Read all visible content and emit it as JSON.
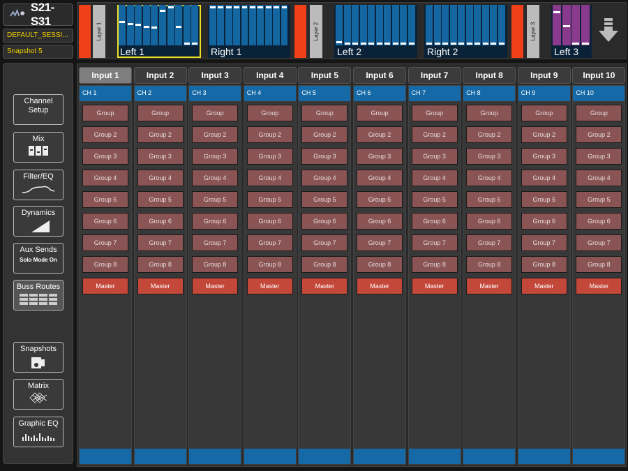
{
  "header": {
    "app_title": "S21-S31",
    "session_name": "DEFAULT_SESSI...",
    "snapshot_name": "Snapshot 5"
  },
  "layers": [
    {
      "tab_label": "Layer 1",
      "groups": [
        {
          "label": "Left 1",
          "selected": true,
          "color": "#1466a0",
          "fader_levels": [
            0.59,
            0.53,
            0.51,
            0.46,
            0.44,
            0.87,
            0.97,
            0.45,
            0.01,
            0.01
          ]
        },
        {
          "label": "Right 1",
          "selected": false,
          "color": "#1466a0",
          "fader_levels": [
            0.97,
            0.97,
            0.97,
            0.97,
            0.97,
            0.97,
            0.97,
            0.97,
            0.97,
            0.97
          ]
        }
      ]
    },
    {
      "tab_label": "Layer 2",
      "groups": [
        {
          "label": "Left 2",
          "selected": false,
          "color": "#1466a0",
          "fader_levels": [
            0.05,
            0.01,
            0.01,
            0.01,
            0.01,
            0.01,
            0.01,
            0.01,
            0.01,
            0.01
          ]
        },
        {
          "label": "Right 2",
          "selected": false,
          "color": "#1466a0",
          "fader_levels": [
            0.01,
            0.01,
            0.01,
            0.01,
            0.01,
            0.01,
            0.01,
            0.01,
            0.01,
            0.01
          ]
        }
      ]
    },
    {
      "tab_label": "Layer 3",
      "groups": [
        {
          "label": "Left 3",
          "selected": false,
          "color": "#8a3a8c",
          "fader_levels": [
            0.83,
            0.48,
            0.01,
            0.01
          ]
        }
      ]
    }
  ],
  "sidebar": {
    "items": [
      {
        "label": "Channel Setup",
        "sub": "",
        "icon": "none",
        "active": false
      },
      {
        "label": "Mix",
        "sub": "",
        "icon": "mix-faders-icon",
        "active": false
      },
      {
        "label": "Filter/EQ",
        "sub": "",
        "icon": "eq-curve-icon",
        "active": false
      },
      {
        "label": "Dynamics",
        "sub": "",
        "icon": "dynamics-ramp-icon",
        "active": false
      },
      {
        "label": "Aux Sends",
        "sub": "Solo Mode On",
        "icon": "none",
        "active": false
      },
      {
        "label": "Buss Routes",
        "sub": "",
        "icon": "buss-grid-icon",
        "active": true
      },
      {
        "label": "Snapshots",
        "sub": "",
        "icon": "snapshot-icon",
        "active": false
      },
      {
        "label": "Matrix",
        "sub": "",
        "icon": "matrix-mesh-icon",
        "active": false
      },
      {
        "label": "Graphic EQ",
        "sub": "",
        "icon": "graphic-eq-icon",
        "active": false
      }
    ]
  },
  "channels": [
    {
      "header": "Input 1",
      "ch": "CH 1",
      "active": true
    },
    {
      "header": "Input 2",
      "ch": "CH 2",
      "active": false
    },
    {
      "header": "Input 3",
      "ch": "CH 3",
      "active": false
    },
    {
      "header": "Input 4",
      "ch": "CH 4",
      "active": false
    },
    {
      "header": "Input 5",
      "ch": "CH 5",
      "active": false
    },
    {
      "header": "Input 6",
      "ch": "CH 6",
      "active": false
    },
    {
      "header": "Input 7",
      "ch": "CH 7",
      "active": false
    },
    {
      "header": "Input 8",
      "ch": "CH 8",
      "active": false
    },
    {
      "header": "Input 9",
      "ch": "CH 9",
      "active": false
    },
    {
      "header": "Input 10",
      "ch": "CH 10",
      "active": false
    }
  ],
  "routes": [
    "Group",
    "Group 2",
    "Group 3",
    "Group 4",
    "Group 5",
    "Group 6",
    "Group 7",
    "Group 8",
    "Master"
  ],
  "colors": {
    "accent_blue": "#1569a6",
    "route_group": "#8a5454",
    "route_master": "#c4483a",
    "selection_yellow": "#f0e020",
    "layer_red": "#f0401a"
  }
}
